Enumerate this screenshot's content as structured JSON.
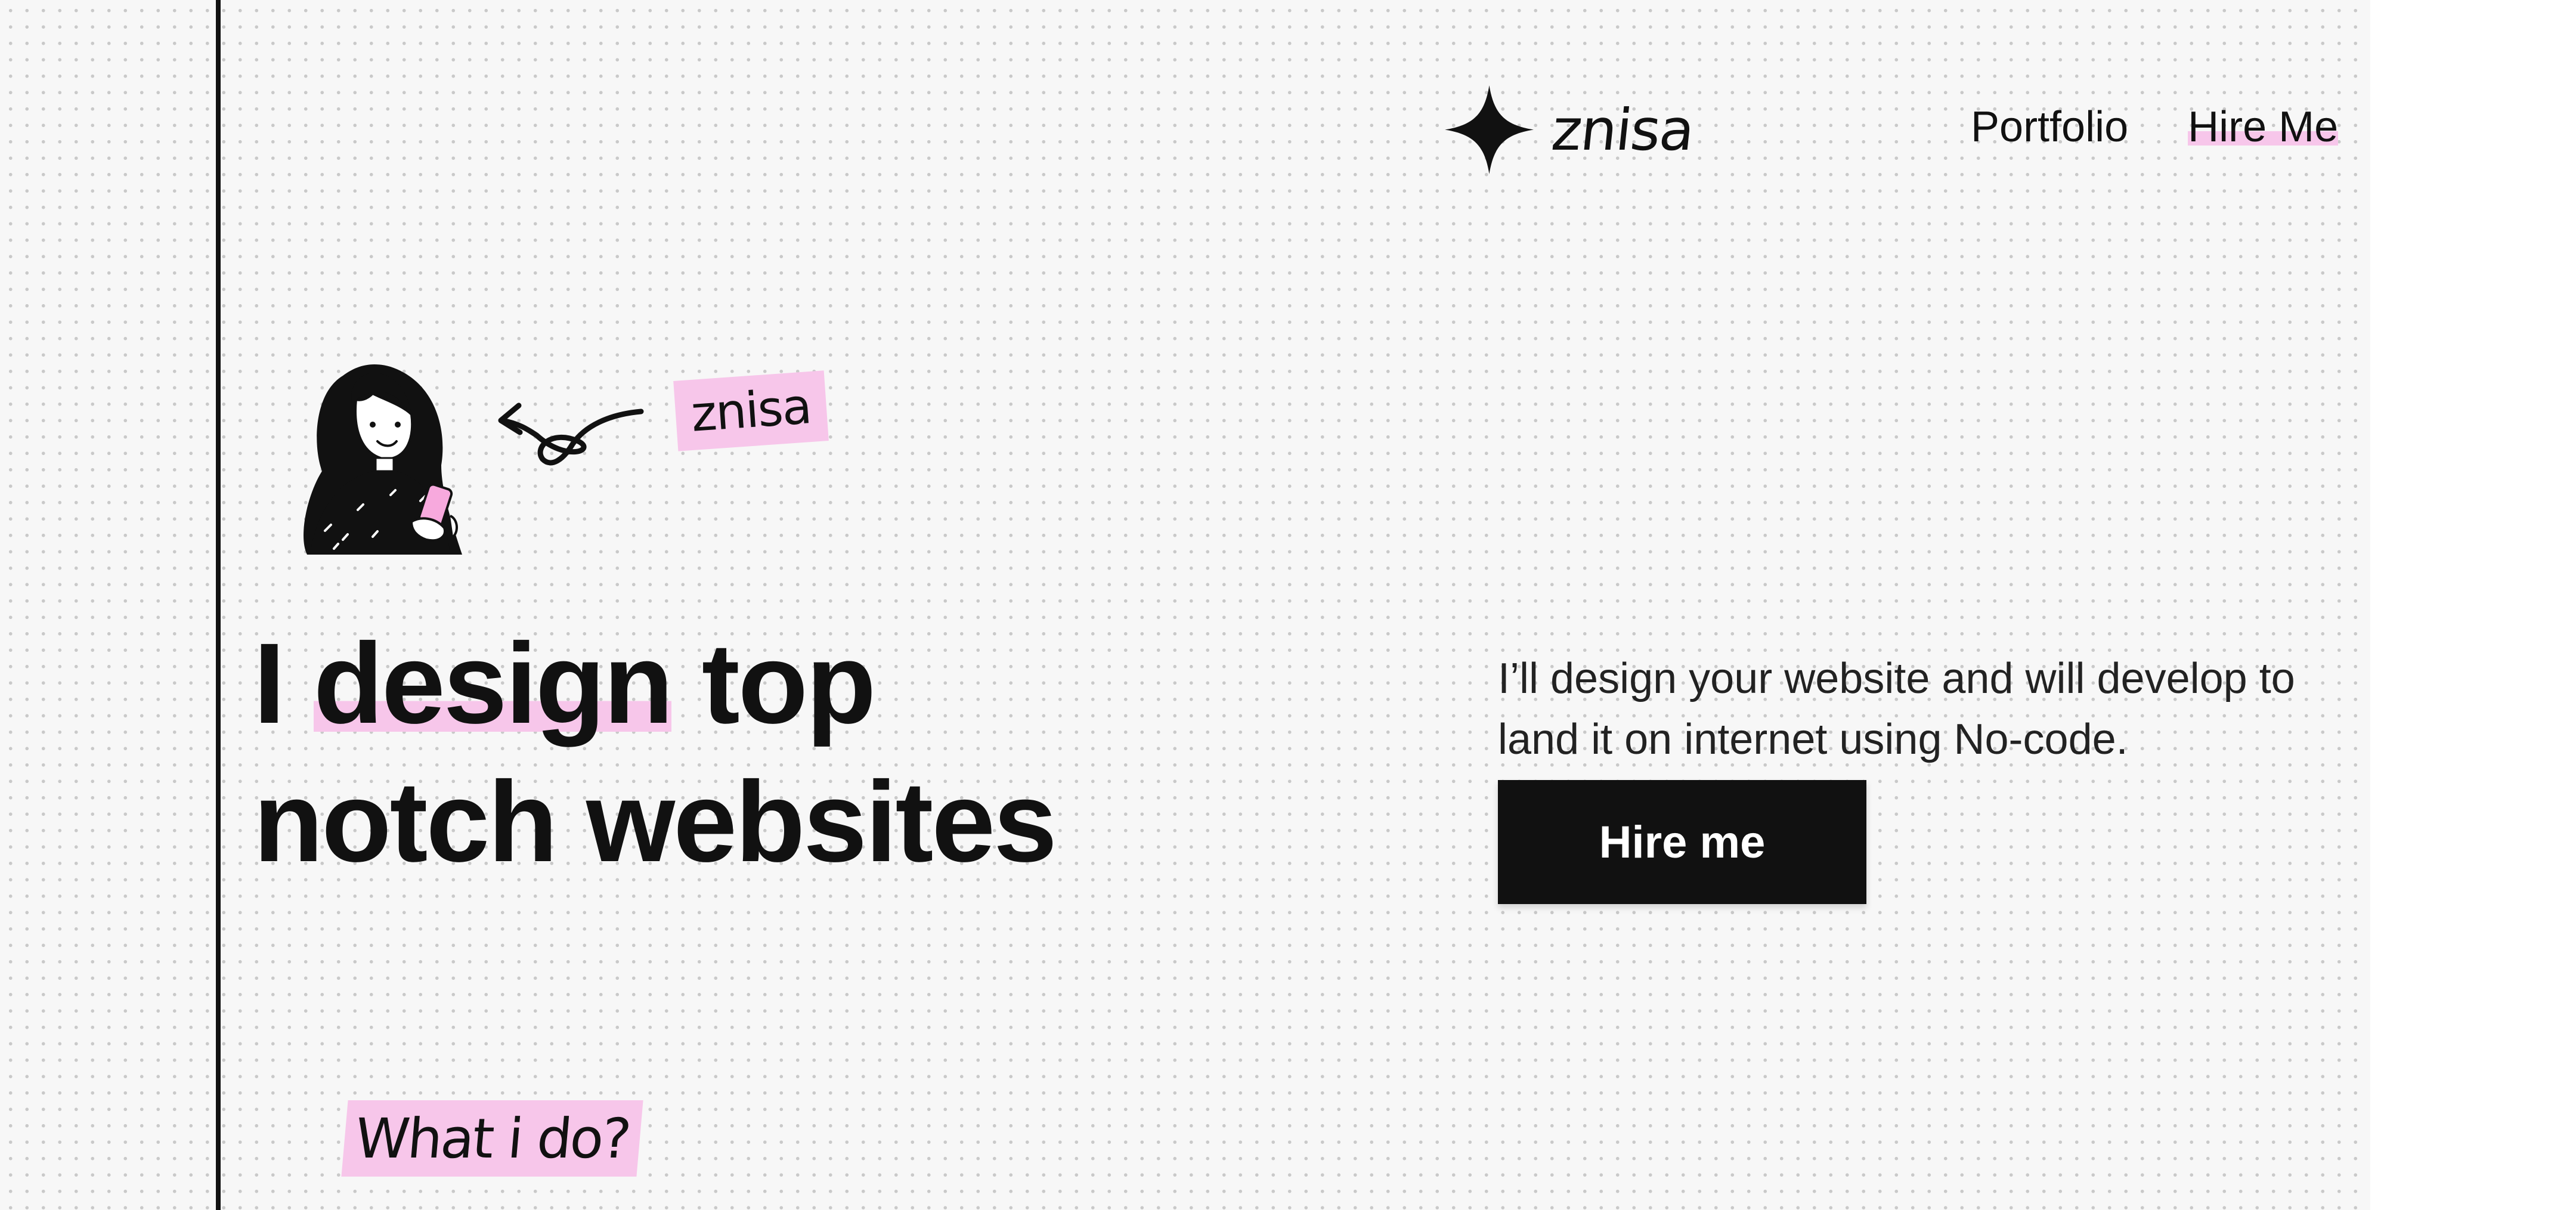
{
  "brand": {
    "logo_icon": "four-point-star-icon",
    "name": "znisa"
  },
  "nav": {
    "items": [
      {
        "label": "Portfolio"
      },
      {
        "label": "Hire Me"
      }
    ]
  },
  "hero": {
    "avatar_icon": "woman-with-phone-illustration",
    "arrow_icon": "loop-arrow-icon",
    "name_tag": "znisa",
    "headline": {
      "line1_start": "I ",
      "line1_highlight": "design",
      "line1_end": " top",
      "line2": "notch websites"
    },
    "intro": "I’ll design your website and will develop to land it on internet using No-code.",
    "cta_label": "Hire me"
  },
  "section": {
    "label": "What i do?"
  },
  "colors": {
    "ink": "#111111",
    "highlight_pink": "#f7c6ea",
    "page_background": "#f7f7f7",
    "dot_grid": "#c9c9c9",
    "button_text": "#ffffff"
  }
}
